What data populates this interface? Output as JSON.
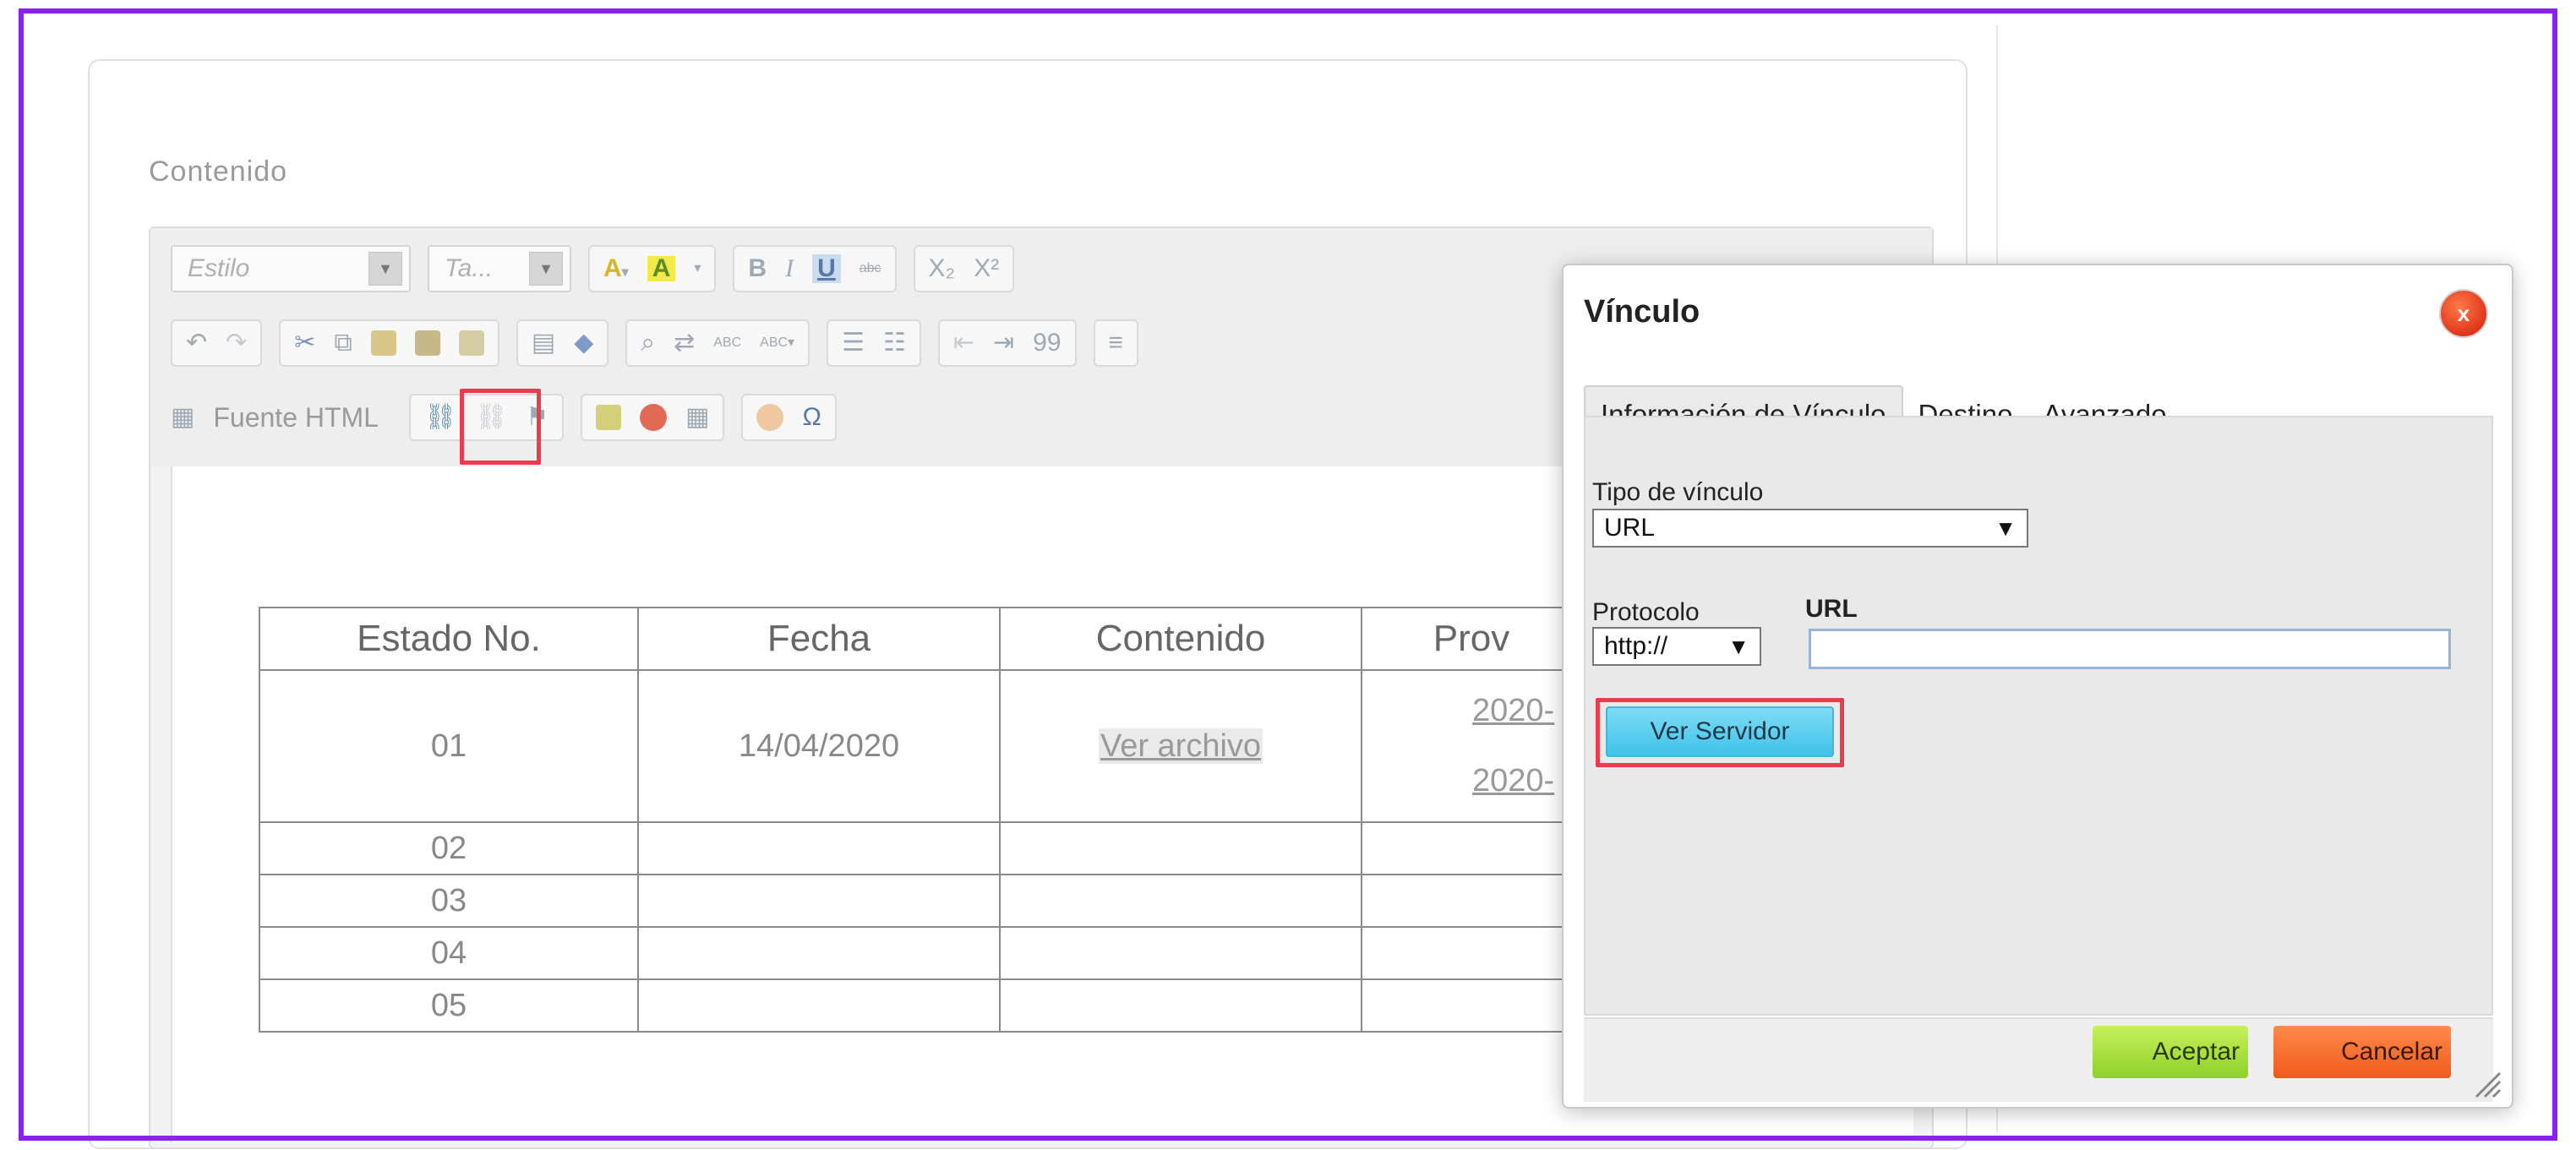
{
  "panel": {
    "label": "Contenido"
  },
  "toolbar": {
    "style_combo": "Estilo",
    "size_combo": "Ta...",
    "text_color": "A",
    "bg_color": "A",
    "bold": "B",
    "italic": "I",
    "underline": "U",
    "strike": "abc",
    "subscript": "X₂",
    "superscript": "X²",
    "source_label": "Fuente HTML",
    "quote": "99"
  },
  "table": {
    "headers": [
      "Estado No.",
      "Fecha",
      "Contenido",
      "Prov"
    ],
    "row1": {
      "num": "01",
      "date": "14/04/2020",
      "link": "Ver archivo",
      "prov_a": "2020-",
      "prov_b": "2020-"
    },
    "rows": [
      "02",
      "03",
      "04",
      "05"
    ]
  },
  "dialog": {
    "title": "Vínculo",
    "close": "x",
    "tabs": [
      "Información de Vínculo",
      "Destino",
      "Avanzado"
    ],
    "link_type_label": "Tipo de vínculo",
    "link_type_value": "URL",
    "protocol_label": "Protocolo",
    "protocol_value": "http://",
    "url_label": "URL",
    "url_value": "",
    "browse_server": "Ver Servidor",
    "ok": "Aceptar",
    "cancel": "Cancelar"
  },
  "colors": {
    "frame": "#8b21f2",
    "highlight": "#ea3c4c",
    "ok": "#8fd12a",
    "cancel": "#f05a1a",
    "server": "#3fc2ea"
  }
}
